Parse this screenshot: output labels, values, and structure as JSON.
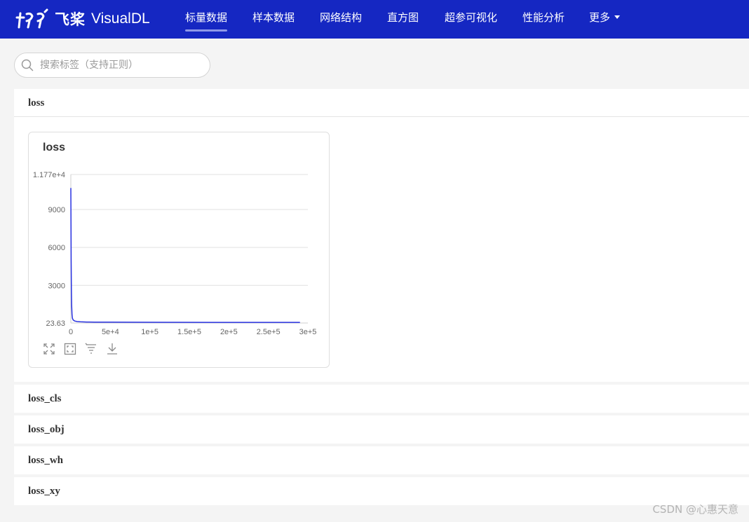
{
  "brand": {
    "name_cn": "飞桨",
    "name_en": "VisualDL"
  },
  "nav": {
    "items": [
      {
        "label": "标量数据",
        "active": true
      },
      {
        "label": "样本数据"
      },
      {
        "label": "网络结构"
      },
      {
        "label": "直方图"
      },
      {
        "label": "超参可视化"
      },
      {
        "label": "性能分析"
      },
      {
        "label": "更多"
      }
    ]
  },
  "search": {
    "placeholder": "搜索标签（支持正则）",
    "value": ""
  },
  "groups": [
    {
      "name": "loss",
      "expanded": true
    },
    {
      "name": "loss_cls"
    },
    {
      "name": "loss_obj"
    },
    {
      "name": "loss_wh"
    },
    {
      "name": "loss_xy"
    }
  ],
  "card": {
    "title": "loss",
    "tools": [
      "maximize-icon",
      "restore-view-icon",
      "toggle-y-axis-icon",
      "download-icon"
    ]
  },
  "chart_data": {
    "type": "line",
    "title": "loss",
    "yticks": [
      "1.177e+4",
      "9000",
      "6000",
      "3000",
      "23.63"
    ],
    "xticks": [
      "0",
      "5e+4",
      "1e+5",
      "1.5e+5",
      "2e+5",
      "2.5e+5",
      "3e+5"
    ],
    "xlim": [
      0,
      300000
    ],
    "ylim": [
      23.63,
      11770
    ],
    "grid": true,
    "line_color": "#2932e1",
    "series": [
      {
        "x": [
          0,
          200,
          400,
          700,
          1000,
          1500,
          2000,
          3000,
          5000,
          8000,
          12000,
          20000,
          30000,
          50000,
          80000,
          120000,
          180000,
          240000,
          290000
        ],
        "y": [
          10700,
          7800,
          5000,
          2700,
          1500,
          700,
          400,
          260,
          180,
          140,
          120,
          100,
          95,
          90,
          85,
          80,
          75,
          72,
          70
        ]
      }
    ]
  },
  "watermark": "CSDN @心惠天意"
}
